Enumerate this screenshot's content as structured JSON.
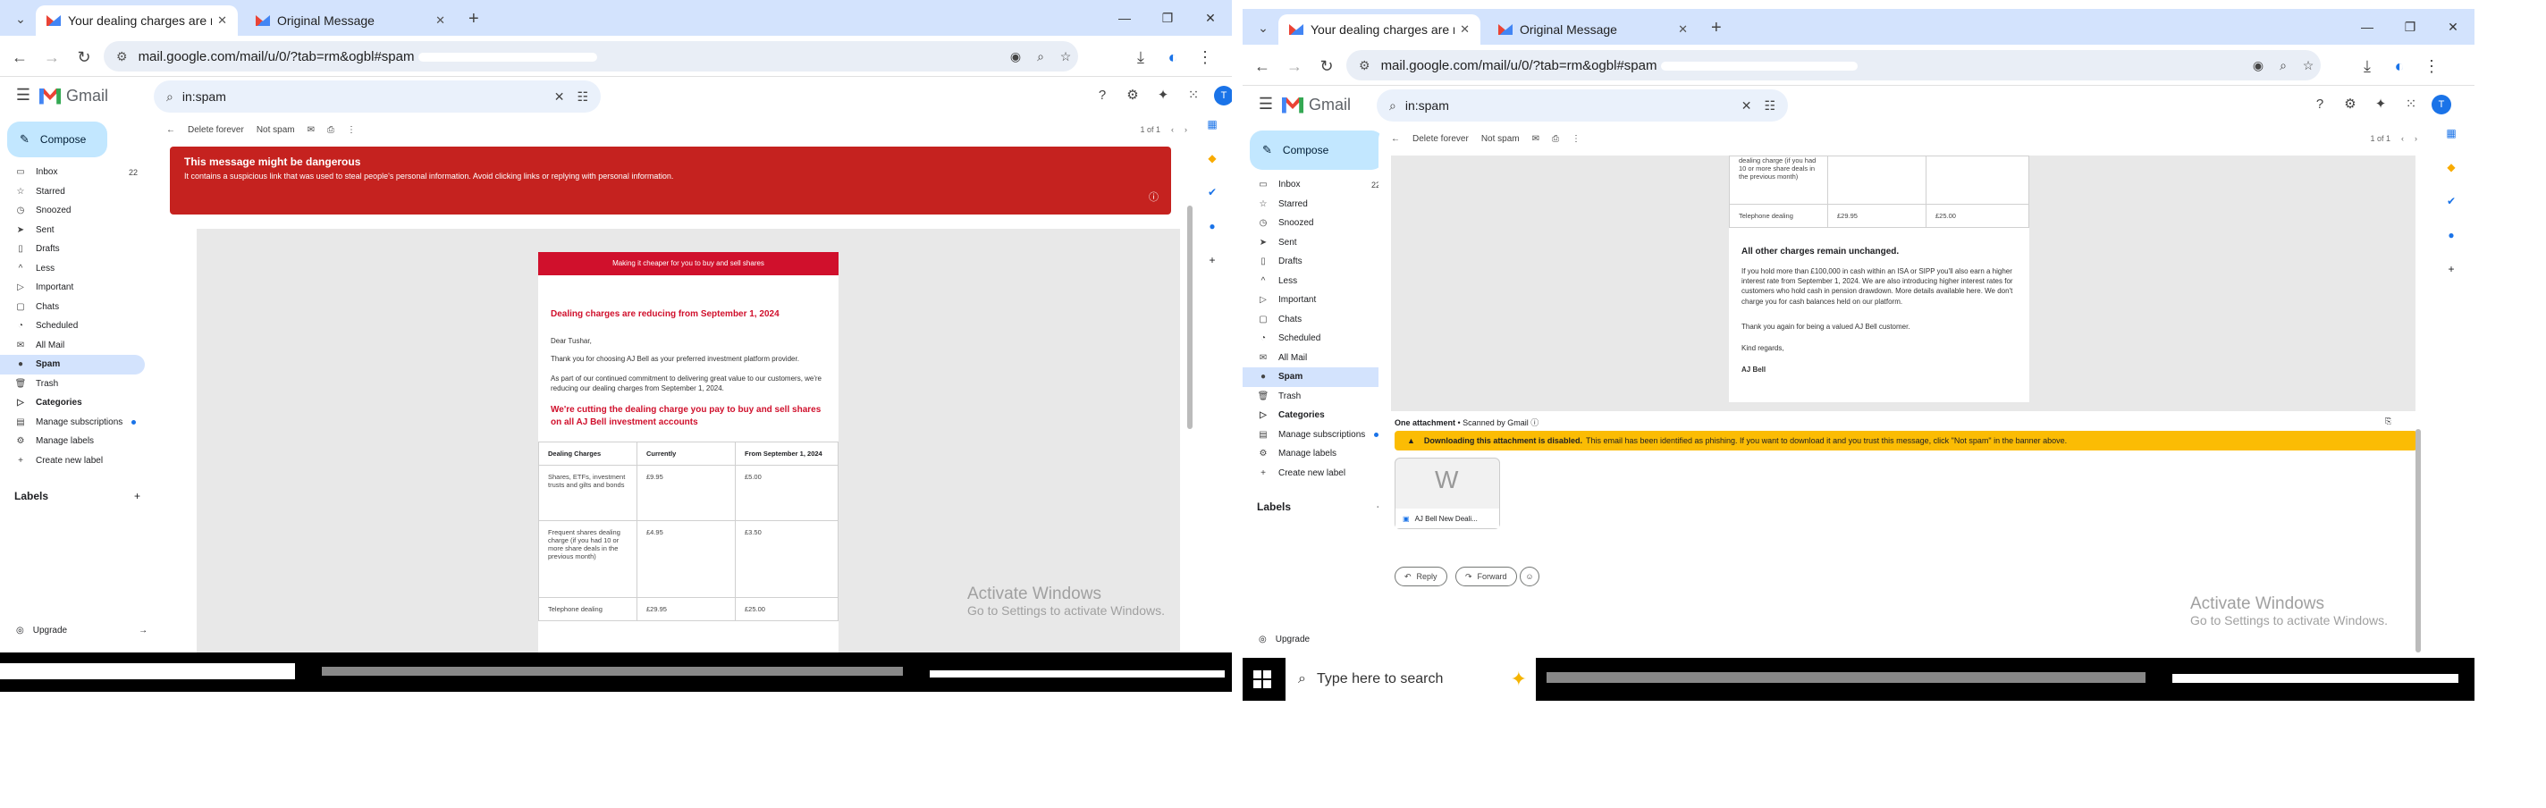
{
  "browser": {
    "tabs": [
      {
        "title": "Your dealing charges are reduc"
      },
      {
        "title": "Original Message"
      }
    ],
    "url": "mail.google.com/mail/u/0/?tab=rm&ogbl#spam"
  },
  "gmail": {
    "brand": "Gmail",
    "search_value": "in:spam",
    "compose": "Compose",
    "nav": [
      {
        "label": "Inbox",
        "icon": "inbox-icon",
        "count": "22"
      },
      {
        "label": "Starred",
        "icon": "star-icon"
      },
      {
        "label": "Snoozed",
        "icon": "clock-icon"
      },
      {
        "label": "Sent",
        "icon": "send-icon"
      },
      {
        "label": "Drafts",
        "icon": "draft-icon"
      },
      {
        "label": "Less",
        "icon": "chevron-up-icon"
      },
      {
        "label": "Important",
        "icon": "important-icon"
      },
      {
        "label": "Chats",
        "icon": "chat-icon"
      },
      {
        "label": "Scheduled",
        "icon": "schedule-icon"
      },
      {
        "label": "All Mail",
        "icon": "all-mail-icon"
      },
      {
        "label": "Spam",
        "icon": "spam-icon"
      },
      {
        "label": "Trash",
        "icon": "trash-icon"
      },
      {
        "label": "Categories",
        "icon": "categories-icon"
      },
      {
        "label": "Manage subscriptions",
        "icon": "subscriptions-icon"
      },
      {
        "label": "Manage labels",
        "icon": "gear-icon"
      },
      {
        "label": "Create new label",
        "icon": "plus-icon"
      }
    ],
    "labels_heading": "Labels",
    "upgrade": "Upgrade",
    "toolbar": {
      "delete": "Delete forever",
      "not_spam": "Not spam",
      "pagination": "1 of 1"
    },
    "warning": {
      "title": "This message might be dangerous",
      "text": "It contains a suspicious link that was used to steal people's personal information. Avoid clicking links or replying with personal information."
    },
    "email": {
      "banner": "Making it cheaper for you to buy and sell shares",
      "heading": "Dealing charges are reducing from September 1, 2024",
      "greeting": "Dear Tushar,",
      "p1": "Thank you for choosing AJ Bell as your preferred investment platform provider.",
      "p2": "As part of our continued commitment to delivering great value to our customers, we're reducing our dealing charges from September 1, 2024.",
      "subhead": "We're cutting the dealing charge you pay to buy and sell shares on all AJ Bell investment accounts",
      "table": {
        "headers": [
          "Dealing Charges",
          "Currently",
          "From September 1, 2024"
        ],
        "rows": [
          [
            "Shares, ETFs, investment trusts and gilts and bonds",
            "£9.95",
            "£5.00"
          ],
          [
            "Frequent shares dealing charge (if you had 10 or more share deals in the previous month)",
            "£4.95",
            "£3.50"
          ],
          [
            "Telephone dealing",
            "£29.95",
            "£25.00"
          ]
        ]
      },
      "other_charges": "All other charges remain unchanged.",
      "p3": "If you hold more than £100,000 in cash within an ISA or SIPP you'll also earn a higher interest rate from September 1, 2024. We are also introducing higher interest rates for customers who hold cash in pension drawdown. More details available here. We don't charge you for cash balances held on our platform.",
      "p4": "Thank you again for being a valued AJ Bell customer.",
      "regards": "Kind regards,",
      "signature": "AJ Bell",
      "partial_row_text": "dealing charge (if you had 10 or more share deals in the previous month)"
    },
    "attachment": {
      "heading": "One attachment",
      "scanned": "• Scanned by Gmail",
      "warning_bold": "Downloading this attachment is disabled.",
      "warning_text": "This email has been identified as phishing. If you want to download it and you trust this message, click \"Not spam\" in the banner above.",
      "filename": "AJ Bell New Deali..."
    },
    "reply": "Reply",
    "forward": "Forward"
  },
  "activate": {
    "title": "Activate Windows",
    "sub": "Go to Settings to activate Windows."
  },
  "taskbar": {
    "search": "Type here to search"
  }
}
